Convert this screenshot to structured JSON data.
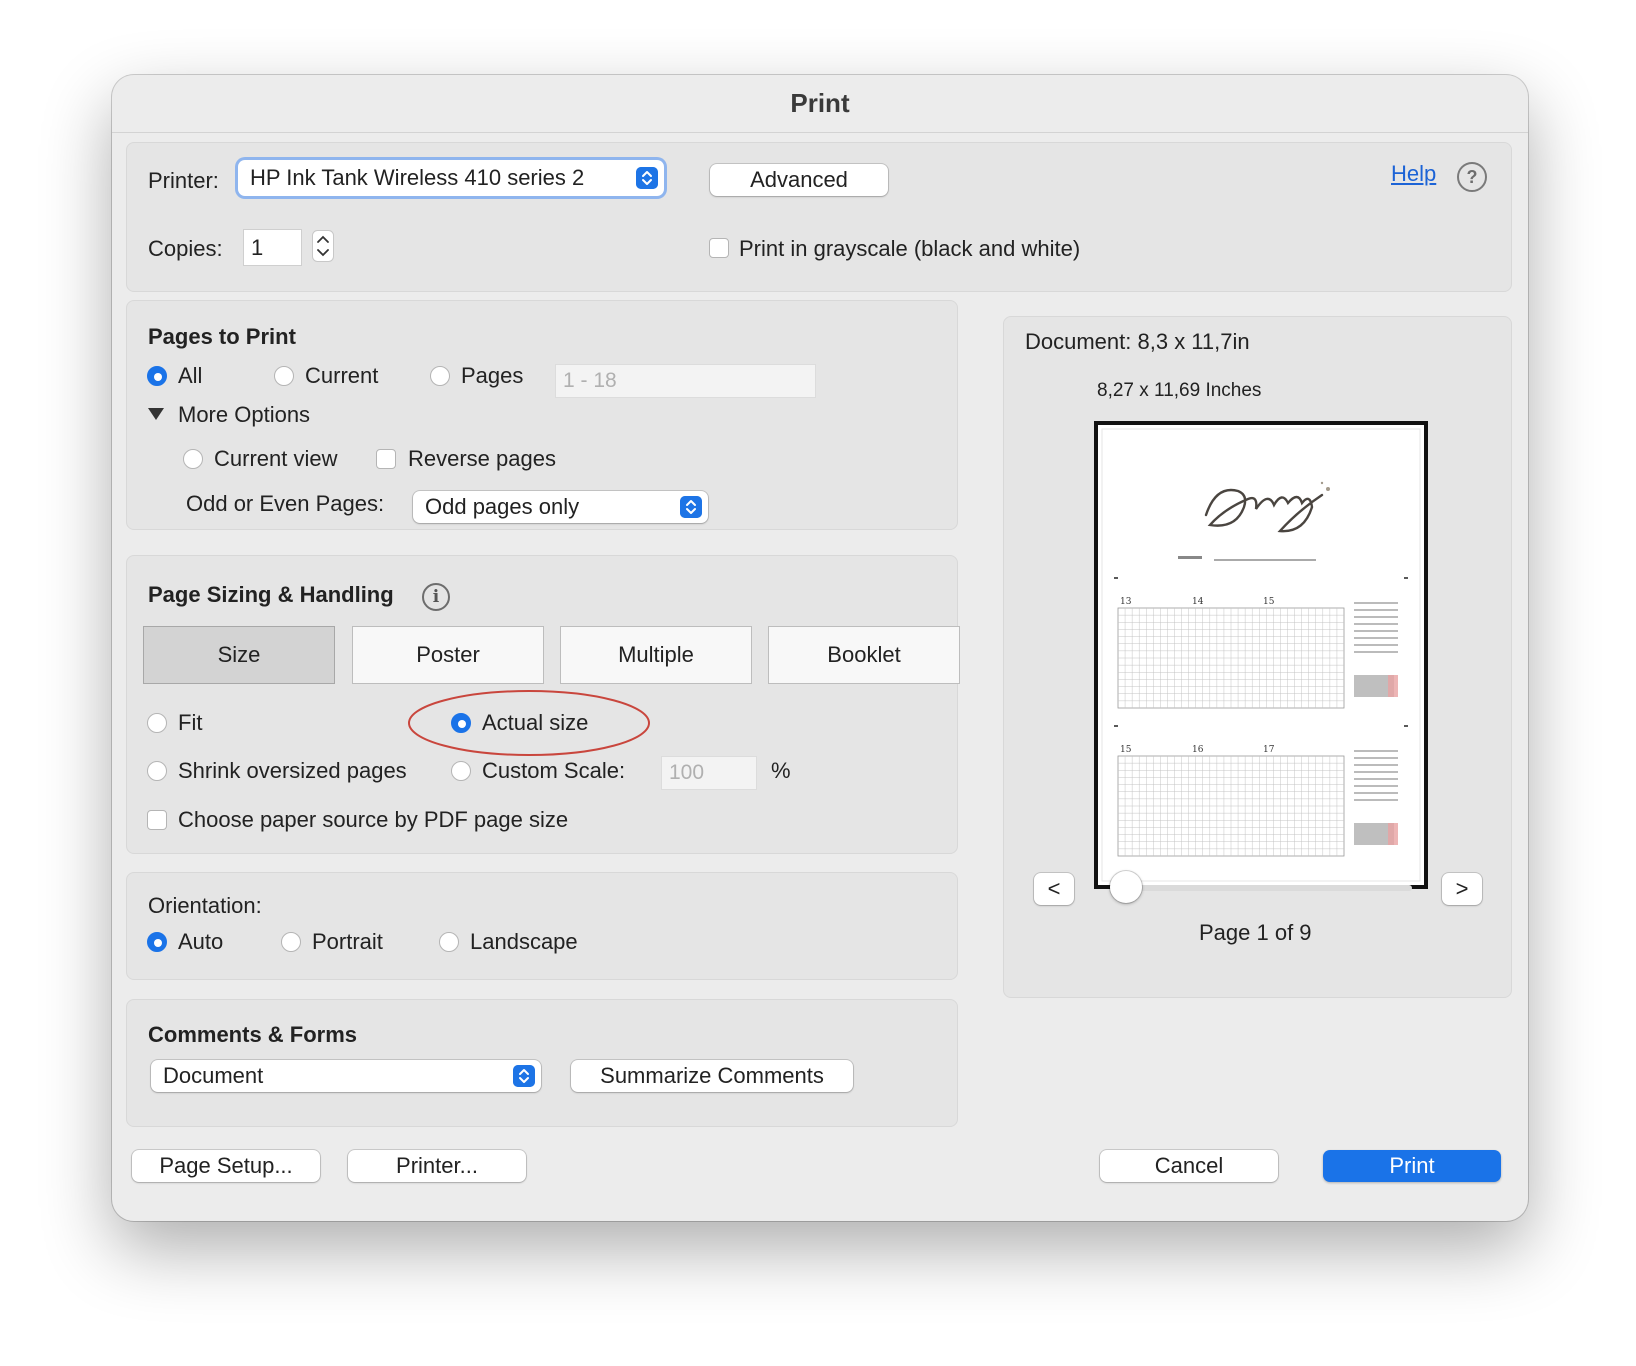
{
  "window": {
    "title": "Print"
  },
  "printer": {
    "label": "Printer:",
    "selected": "HP Ink Tank Wireless 410 series 2",
    "advanced_label": "Advanced",
    "help_label": "Help",
    "help_icon": "?"
  },
  "copies": {
    "label": "Copies:",
    "value": "1",
    "grayscale_label": "Print in grayscale (black and white)",
    "grayscale_checked": false
  },
  "pages_to_print": {
    "header": "Pages to Print",
    "options": [
      "All",
      "Current",
      "Pages"
    ],
    "selected": "All",
    "pages_range_placeholder": "1 - 18",
    "more_options_label": "More Options",
    "current_view_label": "Current view",
    "reverse_pages_label": "Reverse pages",
    "odd_even_label": "Odd or Even Pages:",
    "odd_even_selected": "Odd pages only"
  },
  "page_sizing": {
    "header": "Page Sizing & Handling",
    "info_icon": "i",
    "tabs": [
      "Size",
      "Poster",
      "Multiple",
      "Booklet"
    ],
    "selected_tab": "Size",
    "fit_label": "Fit",
    "actual_size_label": "Actual size",
    "selected_option": "Actual size",
    "shrink_label": "Shrink oversized pages",
    "custom_scale_label": "Custom Scale:",
    "custom_scale_value": "100",
    "percent_symbol": "%",
    "paper_source_label": "Choose paper source by PDF page size"
  },
  "orientation": {
    "label": "Orientation:",
    "options": [
      "Auto",
      "Portrait",
      "Landscape"
    ],
    "selected": "Auto"
  },
  "comments_forms": {
    "header": "Comments & Forms",
    "selected": "Document",
    "summarize_label": "Summarize Comments"
  },
  "preview": {
    "document_size": "Document: 8,3 x 11,7in",
    "paper_size": "8,27 x 11,69 Inches",
    "prev_label": "<",
    "next_label": ">",
    "page_indicator": "Page 1 of 9",
    "day_numbers_top": [
      "13",
      "14",
      "15"
    ],
    "day_numbers_bottom": [
      "15",
      "16",
      "17"
    ]
  },
  "footer": {
    "page_setup_label": "Page Setup...",
    "printer_label": "Printer...",
    "cancel_label": "Cancel",
    "print_label": "Print"
  },
  "colors": {
    "accent": "#1a73e8",
    "annotation_red": "#c9463d",
    "window_bg": "#ececec"
  }
}
